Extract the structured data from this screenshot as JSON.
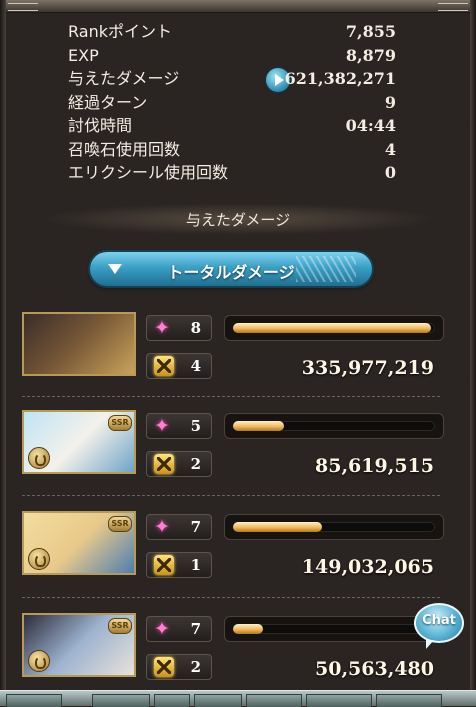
{
  "stats": [
    {
      "label": "Rankポイント",
      "value": "7,855"
    },
    {
      "label": "EXP",
      "value": "8,879"
    },
    {
      "label": "与えたダメージ",
      "value": "621,382,271"
    },
    {
      "label": "経過ターン",
      "value": "9"
    },
    {
      "label": "討伐時間",
      "value": "04:44"
    },
    {
      "label": "召喚石使用回数",
      "value": "4"
    },
    {
      "label": "エリクシール使用回数",
      "value": "0"
    }
  ],
  "section_title": "与えたダメージ",
  "total_damage_button": "トータルダメージ",
  "members": [
    {
      "skill_count": "8",
      "ougi_count": "4",
      "damage": "335,977,219",
      "bar_fraction": 0.98,
      "ssr": "",
      "colors": [
        "#3a2c2a",
        "#7a5a38",
        "#c9a35a"
      ]
    },
    {
      "skill_count": "5",
      "ougi_count": "2",
      "damage": "85,619,515",
      "bar_fraction": 0.25,
      "ssr": "SSR",
      "colors": [
        "#bfe4f5",
        "#f4f1ea",
        "#6fa3c8"
      ]
    },
    {
      "skill_count": "7",
      "ougi_count": "1",
      "damage": "149,032,065",
      "bar_fraction": 0.44,
      "ssr": "SSR",
      "colors": [
        "#f2dda0",
        "#e9c98a",
        "#4e7fb0"
      ]
    },
    {
      "skill_count": "7",
      "ougi_count": "2",
      "damage": "50,563,480",
      "bar_fraction": 0.15,
      "ssr": "SSR",
      "colors": [
        "#2d2d3d",
        "#9db3cf",
        "#e8e2da"
      ]
    }
  ],
  "chat_label": "Chat",
  "colors": {
    "accent": "#3b9fc5",
    "bar_fill": "#f0b95a",
    "skill_icon": "#ff7fd0",
    "ougi_icon": "#ffd54a"
  },
  "icons": {
    "skill": "sparkle-icon",
    "ougi": "ougi-burst-icon",
    "play": "play-icon",
    "dropdown": "triangle-down-icon"
  }
}
